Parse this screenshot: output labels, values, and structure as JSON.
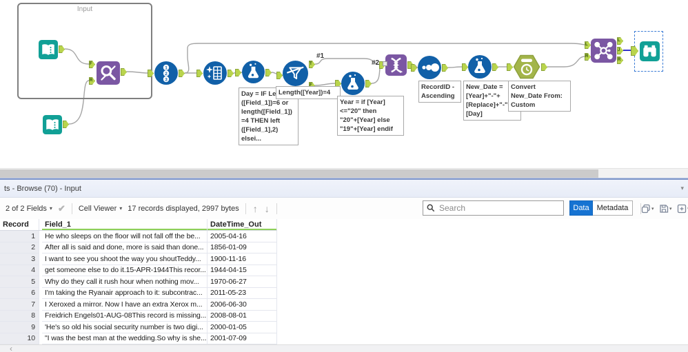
{
  "canvas": {
    "container_label": "Input",
    "connection_labels": {
      "first": "#1",
      "second": "#2"
    },
    "anchors": {
      "find_replace_f": "F",
      "find_replace_r": "R",
      "filter_t": "T",
      "filter_f": "F",
      "join_in_l": "L",
      "join_in_r": "R",
      "join_out_l": "L",
      "join_out_j": "J",
      "join_out_r": "R"
    },
    "annotations": {
      "formula_day": "Day = IF Len\n([Field_1])=6 or\nlength([Field_1])\n=4 THEN left\n([Field_1],2)\nelsei...",
      "filter": "Length([Year])=4",
      "formula_year": "Year = if [Year]\n<=\"20\" then\n\"20\"+[Year] else\n\"19\"+[Year] endif",
      "sort": "RecordID -\nAscending",
      "formula_newdate": "New_Date =\n[Year]+\"-\"+\n[Replace]+\"-\"+\n[Day]",
      "datetime": "Convert\nNew_Date From:\nCustom"
    }
  },
  "results_panel": {
    "tab_title": "ts - Browse (70) - Input",
    "toolbar": {
      "fields_summary": "2 of 2 Fields",
      "cell_viewer_label": "Cell Viewer",
      "records_info": "17 records displayed, 2997 bytes",
      "search_placeholder": "Search",
      "data_button_label": "Data",
      "metadata_button_label": "Metadata"
    },
    "table": {
      "columns": [
        "Record",
        "Field_1",
        "DateTime_Out"
      ],
      "rows": [
        {
          "record": "1",
          "field_1": "He who sleeps on the floor will not fall off the be...",
          "datetime_out": "2005-04-16"
        },
        {
          "record": "2",
          "field_1": "After all is said and done, more is said than done...",
          "datetime_out": "1856-01-09"
        },
        {
          "record": "3",
          "field_1": "I want to see you shoot the way you shoutTeddy...",
          "datetime_out": "1900-11-16"
        },
        {
          "record": "4",
          "field_1": "get someone else to do it.15-APR-1944This recor...",
          "datetime_out": "1944-04-15"
        },
        {
          "record": "5",
          "field_1": "Why do they call it rush hour when nothing mov...",
          "datetime_out": "1970-06-27"
        },
        {
          "record": "6",
          "field_1": "I'm taking the Ryanair approach to it: subcontrac...",
          "datetime_out": "2011-05-23"
        },
        {
          "record": "7",
          "field_1": "I Xeroxed a mirror. Now I have an extra Xerox m...",
          "datetime_out": "2006-06-30"
        },
        {
          "record": "8",
          "field_1": "Freidrich Engels01-AUG-08This record is missing...",
          "datetime_out": "2008-08-01"
        },
        {
          "record": "9",
          "field_1": "'He's so old his social security number is two digi...",
          "datetime_out": "2000-01-05"
        },
        {
          "record": "10",
          "field_1": "\"I was the best man at the wedding.So why is she...",
          "datetime_out": "2001-07-09"
        }
      ]
    }
  },
  "glyphs": {
    "caret": "▾",
    "check": "✔",
    "up": "↑",
    "down": "↓",
    "left_chevron": "‹"
  },
  "icons": {
    "search": "magnifier",
    "copy": "copy-pages",
    "save": "floppy-disk",
    "new_window": "window-plus",
    "dropdown": "caret-down"
  },
  "colors": {
    "tool_blue": "#1160a8",
    "tool_teal": "#11a096",
    "tool_purple": "#7b57a3",
    "anchor_green": "#b9d44d",
    "datetime_green": "#a3b54a",
    "selected_wire_blue": "#3333cc",
    "data_button_blue": "#1673d2",
    "header_underline_green": "#8ed059"
  }
}
